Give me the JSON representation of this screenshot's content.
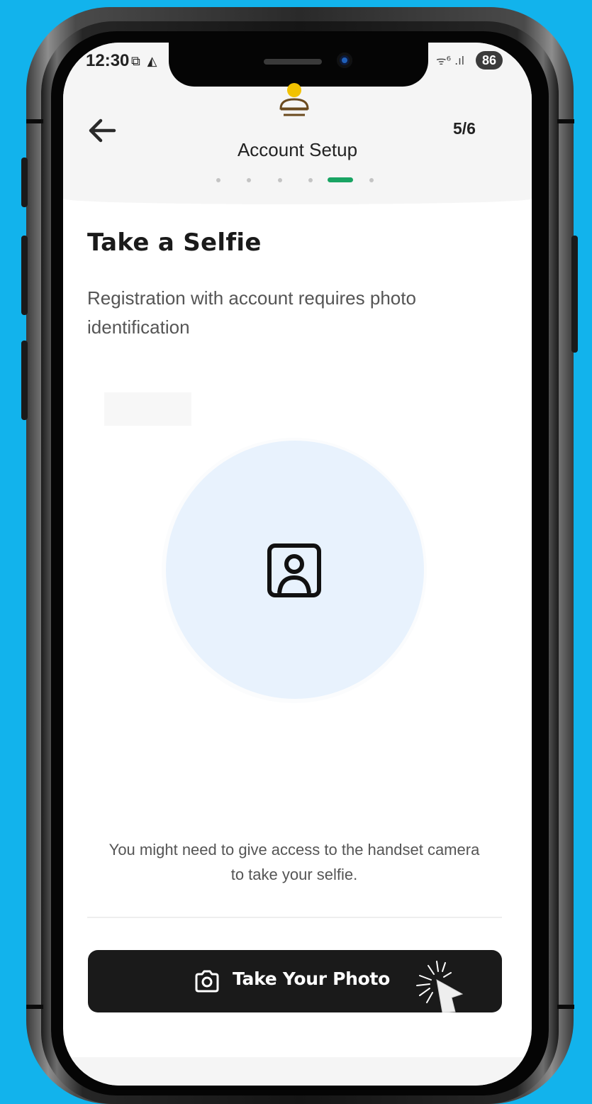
{
  "status_bar": {
    "time": "12:30",
    "left_icons": "⧉ ◭",
    "network": "ᯤ⁶ .ıl",
    "battery": "86"
  },
  "header": {
    "title": "Account Setup",
    "step": "5/6",
    "progress": {
      "total": 6,
      "current": 5
    }
  },
  "content": {
    "title": "Take a Selfie",
    "subtitle": "Registration with account requires photo identification",
    "camera_note": "You might need to give access to the handset camera to take your selfie."
  },
  "actions": {
    "take_photo_label": "Take Your Photo"
  },
  "colors": {
    "background": "#12b3ec",
    "accent": "#19a463",
    "button": "#1a1a1a",
    "photo_circle": "#e8f2fd",
    "logo_yellow": "#f2c200",
    "logo_brown": "#6b4a1e"
  },
  "icons": {
    "back": "arrow-left-icon",
    "logo": "person-logo-icon",
    "photo": "portrait-frame-icon",
    "camera": "camera-icon",
    "pointer": "click-pointer-icon"
  }
}
